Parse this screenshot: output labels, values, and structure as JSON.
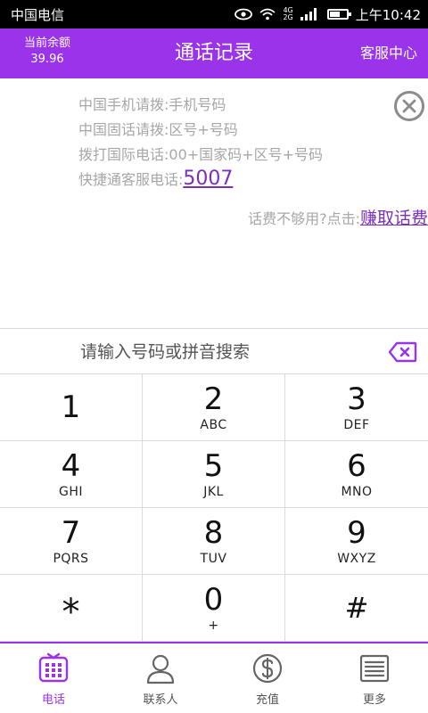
{
  "status_bar": {
    "carrier": "中国电信",
    "net_top": "4G",
    "net_bottom": "2G",
    "time": "上午10:42"
  },
  "header": {
    "balance_label": "当前余额",
    "balance_value": "39.96",
    "title": "通话记录",
    "service_label": "客服中心"
  },
  "info": {
    "line_mobile": "中国手机请拨:手机号码",
    "line_landline": "中国固话请拨:区号+号码",
    "line_international": "拨打国际电话:00+国家码+区号+号码",
    "hotline_label": "快捷通客服电话:",
    "hotline_number": "5007",
    "earn_prompt": "话费不够用?点击:",
    "earn_link": "赚取话费"
  },
  "search": {
    "placeholder": "请输入号码或拼音搜索",
    "value": ""
  },
  "keypad": [
    {
      "digit": "1",
      "letters": ""
    },
    {
      "digit": "2",
      "letters": "ABC"
    },
    {
      "digit": "3",
      "letters": "DEF"
    },
    {
      "digit": "4",
      "letters": "GHI"
    },
    {
      "digit": "5",
      "letters": "JKL"
    },
    {
      "digit": "6",
      "letters": "MNO"
    },
    {
      "digit": "7",
      "letters": "PQRS"
    },
    {
      "digit": "8",
      "letters": "TUV"
    },
    {
      "digit": "9",
      "letters": "WXYZ"
    },
    {
      "digit": "*",
      "letters": ""
    },
    {
      "digit": "0",
      "letters": "+"
    },
    {
      "digit": "#",
      "letters": ""
    }
  ],
  "bottom_nav": [
    {
      "label": "电话",
      "icon": "phone-dialpad-icon",
      "active": true
    },
    {
      "label": "联系人",
      "icon": "contact-person-icon",
      "active": false
    },
    {
      "label": "充值",
      "icon": "dollar-coin-icon",
      "active": false
    },
    {
      "label": "更多",
      "icon": "list-menu-icon",
      "active": false
    }
  ],
  "colors": {
    "accent": "#9b33ea",
    "link": "#7b2fc0",
    "hint_text": "#a7a7a7"
  }
}
